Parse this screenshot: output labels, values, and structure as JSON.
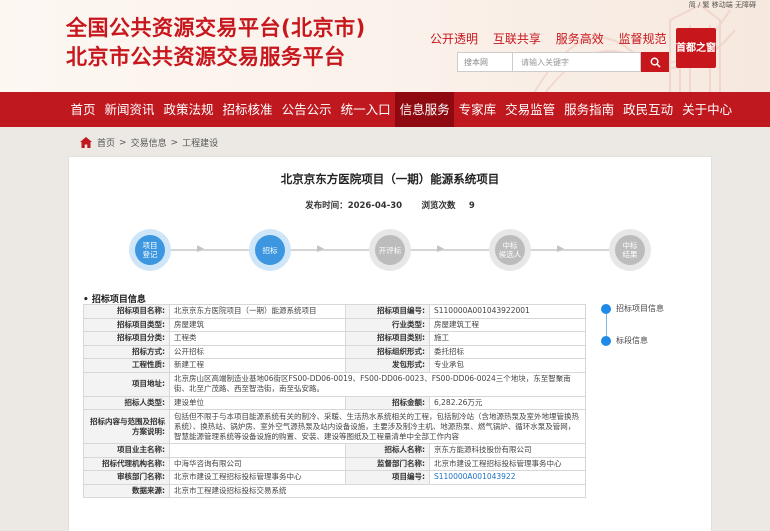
{
  "header": {
    "title_line1": "全国公共资源交易平台(北京市)",
    "title_line2": "北京市公共资源交易服务平台",
    "top_links": "简 / 繁 移动端 无障碍",
    "slogans": [
      "公开透明",
      "互联共享",
      "服务高效",
      "监督规范"
    ],
    "search_scope": "搜本网",
    "search_placeholder": "请输入关键字",
    "logo_text": "首都之窗"
  },
  "nav": {
    "items": [
      "首页",
      "新闻资讯",
      "政策法规",
      "招标核准",
      "公告公示",
      "统一入口",
      "信息服务",
      "专家库",
      "交易监管",
      "服务指南",
      "政民互动",
      "关于中心"
    ],
    "active_index": 6
  },
  "breadcrumb": {
    "items": [
      "首页",
      "交易信息",
      "工程建设"
    ],
    "separator": ">"
  },
  "project": {
    "title": "北京京东方医院项目（一期）能源系统项目",
    "publish_label": "发布时间：",
    "publish_date": "2026-04-30",
    "views_label": "浏览次数",
    "views": "9"
  },
  "process": {
    "steps": [
      {
        "label": "项目\n登记",
        "state": "done"
      },
      {
        "label": "招标",
        "state": "done"
      },
      {
        "label": "开评标",
        "state": "todo"
      },
      {
        "label": "中标\n候选人",
        "state": "todo"
      },
      {
        "label": "中标\n结果",
        "state": "todo"
      }
    ]
  },
  "section": {
    "title": "• 招标项目信息"
  },
  "table": {
    "row1": {
      "l1": "招标项目名称:",
      "v1": "北京京东方医院项目（一期）能源系统项目",
      "l2": "招标项目编号:",
      "v2": "S110000A001043922001"
    },
    "row2": {
      "l1": "招标项目类型:",
      "v1": "房屋建筑",
      "l2": "行业类型:",
      "v2": "房屋建筑工程"
    },
    "row3": {
      "l1": "招标项目分类:",
      "v1": "工程类",
      "l2": "招标项目类别:",
      "v2": "施工"
    },
    "row4": {
      "l1": "招标方式:",
      "v1": "公开招标",
      "l2": "招标组织形式:",
      "v2": "委托招标"
    },
    "row5": {
      "l1": "工程性质:",
      "v1": "新建工程",
      "l2": "发包形式:",
      "v2": "专业承包"
    },
    "row6": {
      "l1": "项目地址:",
      "v1": "北京房山区高端制造业基地06街区FS00-DD06-0019、FS00-DD06-0023、FS00-DD06-0024三个地块，东至智聚南街、北至广茂路、西至智浩街，南至弘安路。"
    },
    "row7": {
      "l1": "招标人类型:",
      "v1": "建设单位",
      "l2": "招标金额:",
      "v2": "6,282.26万元"
    },
    "row8": {
      "l1": "招标内容与范围及招标方案说明:",
      "v1": "包括但不限于与本项目能源系统有关的制冷、采暖、生活热水系统相关的工程，包括制冷站（含地源热泵及室外地埋管换热系统）、换热站、锅炉房、室外空气源热泵及站内设备设施，主要涉及制冷主机、地源热泵、燃气锅炉、循环水泵及管网，智慧能源管理系统等设备设施的购置、安装、建设等图纸及工程量清单中全部工作内容"
    },
    "row9": {
      "l1": "项目业主名称:",
      "v1": "",
      "l2": "招标人名称:",
      "v2": "京东方能源科技股份有限公司"
    },
    "row10": {
      "l1": "招标代理机构名称:",
      "v1": "中海华咨询有限公司",
      "l2": "监督部门名称:",
      "v2": "北京市建设工程招标投标管理事务中心"
    },
    "row11": {
      "l1": "审核部门名称:",
      "v1": "北京市建设工程招标投标管理事务中心",
      "l2": "项目编号:",
      "v2": "S110000A001043922"
    },
    "row12": {
      "l1": "数据来源:",
      "v1": "北京市工程建设招标投标交易系统"
    }
  },
  "side": {
    "items": [
      "招标项目信息",
      "标段信息"
    ],
    "color": "#1f8ae6"
  },
  "colors": {
    "brand_red": "#c0181f",
    "nav_active": "#8e0a10",
    "step_done": "#3c97e0",
    "step_todo": "#bcbcbc"
  }
}
